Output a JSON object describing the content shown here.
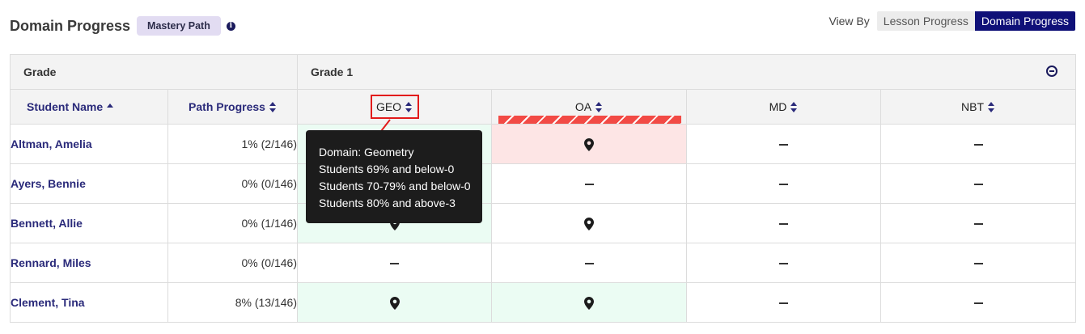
{
  "header": {
    "title": "Domain Progress",
    "badge": "Mastery Path",
    "info_icon": "info-icon"
  },
  "view_by": {
    "label": "View By",
    "options": [
      "Lesson Progress",
      "Domain Progress"
    ],
    "selected": "Domain Progress"
  },
  "table": {
    "grade_label": "Grade",
    "grade_value": "Grade 1",
    "columns": {
      "student_name": "Student Name",
      "path_progress": "Path Progress",
      "domains": [
        "GEO",
        "OA",
        "MD",
        "NBT"
      ]
    },
    "rows": [
      {
        "name": "Altman, Amelia",
        "progress": "1% (2/146)",
        "cells": [
          "",
          "pin",
          "dash",
          "dash"
        ]
      },
      {
        "name": "Ayers, Bennie",
        "progress": "0% (0/146)",
        "cells": [
          "",
          "dash",
          "dash",
          "dash"
        ]
      },
      {
        "name": "Bennett, Allie",
        "progress": "0% (1/146)",
        "cells": [
          "pin",
          "pin",
          "dash",
          "dash"
        ]
      },
      {
        "name": "Rennard, Miles",
        "progress": "0% (0/146)",
        "cells": [
          "dash",
          "dash",
          "dash",
          "dash"
        ]
      },
      {
        "name": "Clement, Tina",
        "progress": "8% (13/146)",
        "cells": [
          "pin",
          "pin",
          "dash",
          "dash"
        ]
      }
    ]
  },
  "tooltip": {
    "lines": [
      "Domain: Geometry",
      "Students 69% and below-0",
      "Students 70-79% and below-0",
      "Students 80% and above-3"
    ]
  },
  "colors": {
    "accent": "#0f1078",
    "link": "#2a2a7a",
    "highlight": "#e21b1b",
    "cell_green": "#ebfcf3",
    "cell_red": "#fde5e5",
    "hatch_red": "#f24a45"
  }
}
